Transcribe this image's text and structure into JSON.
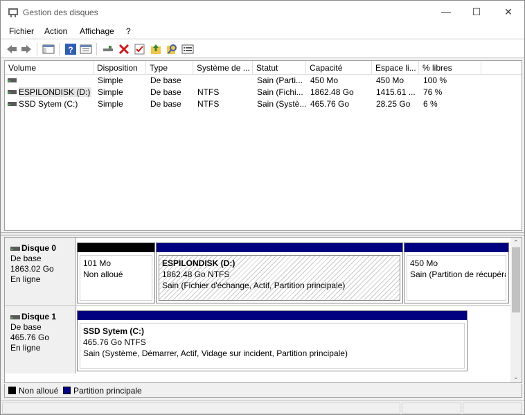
{
  "window": {
    "title": "Gestion des disques",
    "controls": {
      "minimize": "—",
      "maximize": "☐",
      "close": "✕"
    }
  },
  "menu": [
    "Fichier",
    "Action",
    "Affichage",
    "?"
  ],
  "toolbar": {
    "icons": [
      "back-icon",
      "forward-icon",
      "show-hide-console-tree-icon",
      "help-icon",
      "properties-icon",
      "connect-disk-icon",
      "delete-icon",
      "check-icon",
      "folder-up-icon",
      "search-icon",
      "list-view-icon"
    ]
  },
  "volumes": {
    "headers": [
      "Volume",
      "Disposition",
      "Type",
      "Système de ...",
      "Statut",
      "Capacité",
      "Espace li...",
      "% libres"
    ],
    "rows": [
      {
        "volume": "",
        "disposition": "Simple",
        "type": "De base",
        "fs": "",
        "statut": "Sain (Parti...",
        "capacite": "450 Mo",
        "espace": "450 Mo",
        "libres": "100 %"
      },
      {
        "volume": "ESPILONDISK (D:)",
        "disposition": "Simple",
        "type": "De base",
        "fs": "NTFS",
        "statut": "Sain (Fichi...",
        "capacite": "1862.48 Go",
        "espace": "1415.61 ...",
        "libres": "76 %"
      },
      {
        "volume": "SSD Sytem (C:)",
        "disposition": "Simple",
        "type": "De base",
        "fs": "NTFS",
        "statut": "Sain (Systè...",
        "capacite": "465.76 Go",
        "espace": "28.25 Go",
        "libres": "6 %"
      }
    ]
  },
  "disks": [
    {
      "name": "Disque 0",
      "type": "De base",
      "size": "1863.02 Go",
      "status": "En ligne",
      "partitions": [
        {
          "title": "",
          "line1": "101 Mo",
          "line2": "Non alloué",
          "line3": ""
        },
        {
          "title": "ESPILONDISK  (D:)",
          "line1": "1862.48 Go NTFS",
          "line2": "Sain (Fichier d'échange, Actif, Partition principale)",
          "line3": ""
        },
        {
          "title": "",
          "line1": "450 Mo",
          "line2": "Sain (Partition de récupéra",
          "line3": ""
        }
      ]
    },
    {
      "name": "Disque 1",
      "type": "De base",
      "size": "465.76 Go",
      "status": "En ligne",
      "partitions": [
        {
          "title": "SSD Sytem  (C:)",
          "line1": "465.76 Go NTFS",
          "line2": "Sain (Système, Démarrer, Actif, Vidage sur incident, Partition principale)",
          "line3": ""
        }
      ]
    }
  ],
  "legend": [
    {
      "label": "Non alloué",
      "color": "#000000"
    },
    {
      "label": "Partition principale",
      "color": "#00008b"
    }
  ],
  "colors": {
    "primary_partition": "#000080",
    "unallocated": "#000000"
  }
}
